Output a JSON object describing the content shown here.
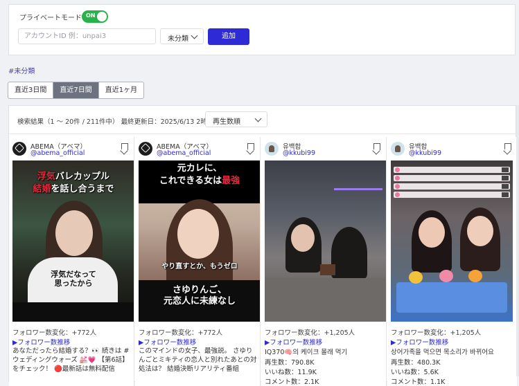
{
  "top_panel": {
    "private_mode_label": "プライベートモード",
    "private_mode_toggle": "ON",
    "account_input_placeholder": "アカウントID 例：unpai3",
    "category_select": "未分類",
    "add_button": "追加"
  },
  "category_tag": "#未分類",
  "period_tabs": [
    {
      "label": "直近3日間",
      "active": false
    },
    {
      "label": "直近7日間",
      "active": true
    },
    {
      "label": "直近1ヶ月",
      "active": false
    }
  ],
  "results": {
    "summary": "検索結果（1 〜 20件 / 211件中） 最終更新日：2025/6/13 2時",
    "sort_select": "再生数順"
  },
  "colors": {
    "accent": "#2d2ad6",
    "toggle_on": "#27b24a",
    "active_tab": "#6d7280"
  },
  "cards": [
    {
      "channel_name": "ABEMA（アベマ）",
      "handle": "@abema_official",
      "thumb_caption_line1_red": "浮気",
      "thumb_caption_line1": "バレカップル",
      "thumb_caption_line2_red": "結婚",
      "thumb_caption_line2": "を話し合うまで",
      "thumb_subtitle": "浮気だなって思ったから",
      "follower_change": "フォロワー数変化：+772人",
      "follower_link": "▶フォロワー数推移",
      "description": "あなただったら結婚する？👀 続きは #ウェディングウォーズ 💒💗 【第6話】をチェック！ 🔴最新話は無料配信"
    },
    {
      "channel_name": "ABEMA（アベマ）",
      "handle": "@abema_official",
      "thumb_caption_line1": "元カレに、",
      "thumb_caption_line2": "これできる女は",
      "thumb_caption_line2_red": "最強",
      "thumb_subtitle": "やり直すとか、もうゼロ",
      "thumb_caption_bottom_red": "さゆりんご、",
      "thumb_caption_bottom": "元恋人に未練なし",
      "follower_change": "フォロワー数変化：+772人",
      "follower_link": "▶フォロワー数推移",
      "description": "このマインドの女子、最強説。 さゆりんごとミキティの恋人と別れたあとの対処法は？ 結婚決断リアリティ番組"
    },
    {
      "channel_name": "유백합",
      "handle": "@kkubi99",
      "follower_change": "フォロワー数変化：+1,205人",
      "follower_link": "▶フォロワー数推移",
      "description": "IQ370🧠의 케이크 몰래 먹기",
      "views": "再生数：790.8K",
      "likes": "いいね数：11.9K",
      "extra": "コメント数：2.1K"
    },
    {
      "channel_name": "유백합",
      "handle": "@kkubi99",
      "follower_change": "フォロワー数変化：+1,205人",
      "follower_link": "▶フォロワー数推移",
      "description": "상어가족을 먹으면 목소리가 바뀌어요",
      "views": "再生数：480.3K",
      "likes": "いいね数：5.6K",
      "extra": "コメント数：1.1K"
    }
  ]
}
